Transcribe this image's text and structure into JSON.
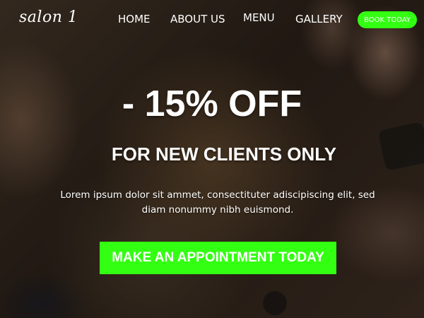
{
  "brand": {
    "logo_text": "salon 1"
  },
  "nav": {
    "items": [
      {
        "label": "HOME"
      },
      {
        "label": "ABOUT US"
      },
      {
        "label": "MENU"
      },
      {
        "label": "GALLERY"
      }
    ],
    "cta_label": "BOOK TODAY"
  },
  "hero": {
    "headline": "- 15% OFF",
    "subheadline": "FOR NEW CLIENTS ONLY",
    "body": "Lorem ipsum dolor sit ammet, consectituter adiscipiscing elit, sed diam nonummy nibh euismond.",
    "cta_label": "MAKE AN APPOINTMENT TODAY"
  },
  "colors": {
    "accent": "#33ff12",
    "text": "#ffffff"
  }
}
